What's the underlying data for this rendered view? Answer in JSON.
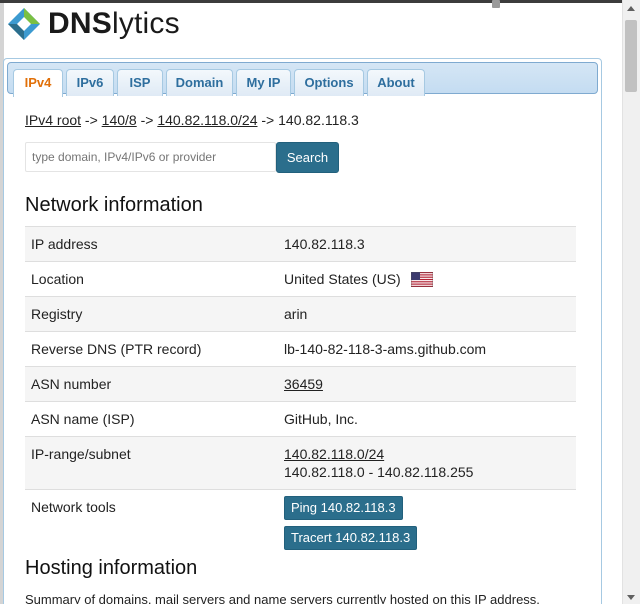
{
  "logo": {
    "text_bold": "DNS",
    "text_rest": "lytics"
  },
  "tabs": [
    {
      "label": "IPv4",
      "active": true
    },
    {
      "label": "IPv6",
      "active": false
    },
    {
      "label": "ISP",
      "active": false
    },
    {
      "label": "Domain",
      "active": false
    },
    {
      "label": "My IP",
      "active": false
    },
    {
      "label": "Options",
      "active": false
    },
    {
      "label": "About",
      "active": false
    }
  ],
  "breadcrumb": {
    "root": "IPv4 root",
    "sep1": " -> ",
    "level1": "140/8",
    "sep2": " -> ",
    "level2": "140.82.118.0/24",
    "sep3": " -> ",
    "current": "140.82.118.3"
  },
  "search": {
    "placeholder": "type domain, IPv4/IPv6 or provider",
    "button_label": "Search"
  },
  "network_info": {
    "title": "Network information",
    "rows": {
      "ip_address": {
        "label": "IP address",
        "value": "140.82.118.3"
      },
      "location": {
        "label": "Location",
        "value": "United States (US)"
      },
      "registry": {
        "label": "Registry",
        "value": "arin"
      },
      "reverse_dns": {
        "label": "Reverse DNS (PTR record)",
        "value": "lb-140-82-118-3-ams.github.com"
      },
      "asn_number": {
        "label": "ASN number",
        "value": "36459"
      },
      "asn_name": {
        "label": "ASN name (ISP)",
        "value": "GitHub, Inc."
      },
      "ip_range": {
        "label": "IP-range/subnet",
        "subnet": "140.82.118.0/24",
        "range": "140.82.118.0 - 140.82.118.255"
      },
      "tools": {
        "label": "Network tools",
        "ping": "Ping 140.82.118.3",
        "tracert": "Tracert 140.82.118.3"
      }
    }
  },
  "hosting": {
    "title": "Hosting information",
    "description": "Summary of domains, mail servers and name servers currently hosted on this IP address."
  },
  "colors": {
    "accent": "#2b6e8c",
    "tab_text": "#2e6e9e",
    "tab_active_text": "#e17009"
  },
  "icons": {
    "flag": "us-flag-icon",
    "logo": "dnslytics-logo-icon"
  }
}
